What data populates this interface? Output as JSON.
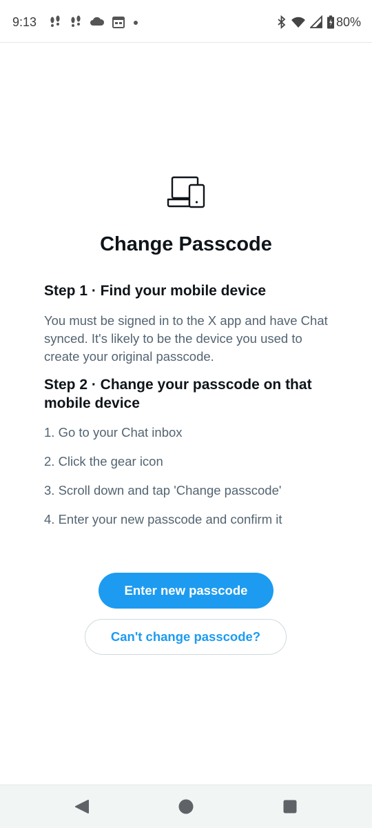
{
  "status_bar": {
    "time": "9:13",
    "battery": "80%",
    "left_icons": [
      "footsteps-icon",
      "footsteps-icon",
      "cloud-icon",
      "calendar-icon",
      "dot-icon"
    ],
    "right_icons": [
      "bluetooth-icon",
      "wifi-icon",
      "cell-signal-icon",
      "battery-icon"
    ]
  },
  "main": {
    "icon": "devices-icon",
    "title": "Change Passcode",
    "step1": {
      "heading": "Step 1 · Find your mobile device",
      "body": "You must be signed in to the X app and have Chat synced. It's likely to be the device you used to create your original passcode."
    },
    "step2": {
      "heading": "Step 2 · Change your passcode on that mobile device",
      "items": [
        "1. Go to your Chat inbox",
        "2. Click the gear icon",
        "3. Scroll down and tap 'Change passcode'",
        "4. Enter your new passcode and confirm it"
      ]
    },
    "primary_button": "Enter new passcode",
    "secondary_button": "Can't change passcode?"
  },
  "colors": {
    "accent": "#1d9bf0",
    "text_primary": "#0f1419",
    "text_secondary": "#536471",
    "border": "#cfd9de"
  },
  "nav_bar": {
    "icons": [
      "back-icon",
      "home-icon",
      "recents-icon"
    ]
  }
}
